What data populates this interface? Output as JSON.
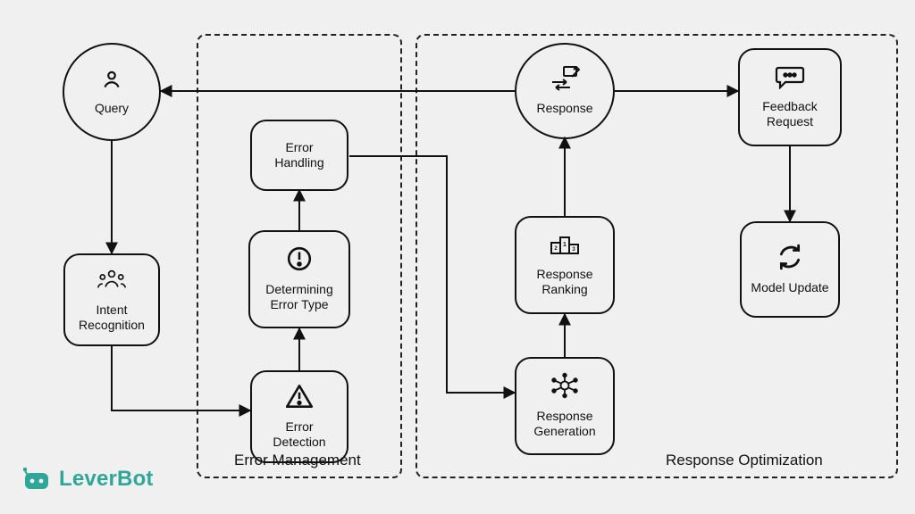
{
  "groups": {
    "error_mgmt": {
      "label": "Error Management"
    },
    "resp_opt": {
      "label": "Response Optimization"
    }
  },
  "nodes": {
    "query": {
      "label": "Query"
    },
    "intent": {
      "label": "Intent Recognition"
    },
    "err_detect": {
      "label": "Error Detection"
    },
    "err_type": {
      "label": "Determining Error Type"
    },
    "err_handle": {
      "label": "Error Handling"
    },
    "resp_gen": {
      "label": "Response Generation"
    },
    "resp_rank": {
      "label": "Response Ranking"
    },
    "response": {
      "label": "Response"
    },
    "feedback": {
      "label": "Feedback Request"
    },
    "model_update": {
      "label": "Model Update"
    }
  },
  "logo": "LeverBot"
}
